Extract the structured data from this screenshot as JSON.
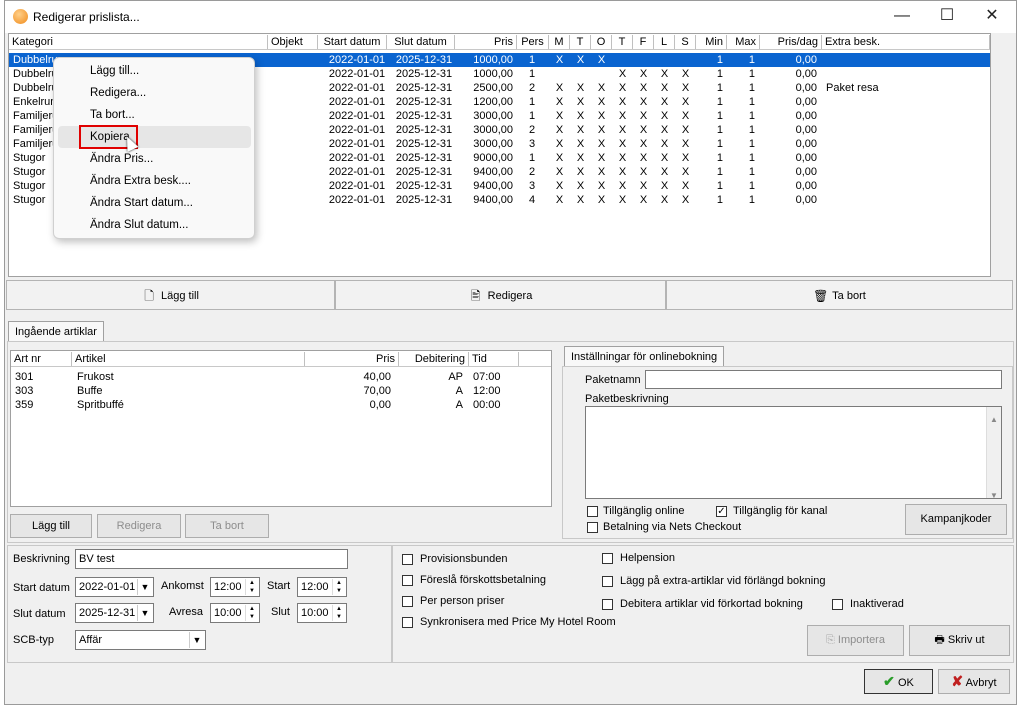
{
  "window": {
    "title": "Redigerar prislista...",
    "minimize": "—",
    "maximize": "☐",
    "close": "✕"
  },
  "grid": {
    "columns": [
      "Kategori",
      "Objekt",
      "Start datum",
      "Slut datum",
      "Pris",
      "Pers",
      "M",
      "T",
      "O",
      "T",
      "F",
      "L",
      "S",
      "Min",
      "Max",
      "Pris/dag",
      "Extra besk."
    ],
    "rows": [
      {
        "kat": "Dubbelru",
        "start": "2022-01-01",
        "slut": "2025-12-31",
        "pris": "1000,00",
        "pers": "1",
        "days": [
          "X",
          "X",
          "X",
          "",
          "",
          "",
          ""
        ],
        "min": "1",
        "max": "1",
        "pd": "0,00",
        "extra": ""
      },
      {
        "kat": "Dubbelru",
        "start": "2022-01-01",
        "slut": "2025-12-31",
        "pris": "1000,00",
        "pers": "1",
        "days": [
          "",
          "",
          "",
          "X",
          "X",
          "X",
          "X"
        ],
        "min": "1",
        "max": "1",
        "pd": "0,00",
        "extra": ""
      },
      {
        "kat": "Dubbelru",
        "start": "2022-01-01",
        "slut": "2025-12-31",
        "pris": "2500,00",
        "pers": "2",
        "days": [
          "X",
          "X",
          "X",
          "X",
          "X",
          "X",
          "X"
        ],
        "min": "1",
        "max": "1",
        "pd": "0,00",
        "extra": "Paket resa"
      },
      {
        "kat": "Enkelrun",
        "start": "2022-01-01",
        "slut": "2025-12-31",
        "pris": "1200,00",
        "pers": "1",
        "days": [
          "X",
          "X",
          "X",
          "X",
          "X",
          "X",
          "X"
        ],
        "min": "1",
        "max": "1",
        "pd": "0,00",
        "extra": ""
      },
      {
        "kat": "Familjeru",
        "start": "2022-01-01",
        "slut": "2025-12-31",
        "pris": "3000,00",
        "pers": "1",
        "days": [
          "X",
          "X",
          "X",
          "X",
          "X",
          "X",
          "X"
        ],
        "min": "1",
        "max": "1",
        "pd": "0,00",
        "extra": ""
      },
      {
        "kat": "Familjeru",
        "start": "2022-01-01",
        "slut": "2025-12-31",
        "pris": "3000,00",
        "pers": "2",
        "days": [
          "X",
          "X",
          "X",
          "X",
          "X",
          "X",
          "X"
        ],
        "min": "1",
        "max": "1",
        "pd": "0,00",
        "extra": ""
      },
      {
        "kat": "Familjeru",
        "start": "2022-01-01",
        "slut": "2025-12-31",
        "pris": "3000,00",
        "pers": "3",
        "days": [
          "X",
          "X",
          "X",
          "X",
          "X",
          "X",
          "X"
        ],
        "min": "1",
        "max": "1",
        "pd": "0,00",
        "extra": ""
      },
      {
        "kat": "Stugor",
        "start": "2022-01-01",
        "slut": "2025-12-31",
        "pris": "9000,00",
        "pers": "1",
        "days": [
          "X",
          "X",
          "X",
          "X",
          "X",
          "X",
          "X"
        ],
        "min": "1",
        "max": "1",
        "pd": "0,00",
        "extra": ""
      },
      {
        "kat": "Stugor",
        "start": "2022-01-01",
        "slut": "2025-12-31",
        "pris": "9400,00",
        "pers": "2",
        "days": [
          "X",
          "X",
          "X",
          "X",
          "X",
          "X",
          "X"
        ],
        "min": "1",
        "max": "1",
        "pd": "0,00",
        "extra": ""
      },
      {
        "kat": "Stugor",
        "start": "2022-01-01",
        "slut": "2025-12-31",
        "pris": "9400,00",
        "pers": "3",
        "days": [
          "X",
          "X",
          "X",
          "X",
          "X",
          "X",
          "X"
        ],
        "min": "1",
        "max": "1",
        "pd": "0,00",
        "extra": ""
      },
      {
        "kat": "Stugor",
        "start": "2022-01-01",
        "slut": "2025-12-31",
        "pris": "9400,00",
        "pers": "4",
        "days": [
          "X",
          "X",
          "X",
          "X",
          "X",
          "X",
          "X"
        ],
        "min": "1",
        "max": "1",
        "pd": "0,00",
        "extra": ""
      }
    ]
  },
  "context_menu": {
    "items": [
      "Lägg till...",
      "Redigera...",
      "Ta bort...",
      "Kopiera",
      "Ändra Pris...",
      "Ändra Extra besk....",
      "Ändra Start datum...",
      "Ändra Slut datum..."
    ],
    "highlighted": "Kopiera"
  },
  "toolbar": {
    "add": "Lägg till",
    "edit": "Redigera",
    "delete": "Ta bort"
  },
  "articles": {
    "tab": "Ingående artiklar",
    "columns": [
      "Art nr",
      "Artikel",
      "Pris",
      "Debitering",
      "Tid"
    ],
    "rows": [
      {
        "nr": "301",
        "name": "Frukost",
        "pris": "40,00",
        "deb": "AP",
        "tid": "07:00"
      },
      {
        "nr": "303",
        "name": "Buffe",
        "pris": "70,00",
        "deb": "A",
        "tid": "12:00"
      },
      {
        "nr": "359",
        "name": "Spritbuffé",
        "pris": "0,00",
        "deb": "A",
        "tid": "00:00"
      }
    ],
    "add": "Lägg till",
    "edit": "Redigera",
    "delete": "Ta bort"
  },
  "online": {
    "tab": "Inställningar för onlinebokning",
    "paketnamn_label": "Paketnamn",
    "paketnamn_value": "",
    "paketbesk_label": "Paketbeskrivning",
    "tillganglig_online": "Tillgänglig online",
    "tillganglig_online_checked": false,
    "tillganglig_kanal": "Tillgänglig för kanal",
    "tillganglig_kanal_checked": true,
    "nets": "Betalning via Nets Checkout",
    "nets_checked": false,
    "kampanj": "Kampanjkoder"
  },
  "form": {
    "beskrivning_label": "Beskrivning",
    "beskrivning": "BV test",
    "start_label": "Start datum",
    "start": "2022-01-01",
    "slut_label": "Slut datum",
    "slut": "2025-12-31",
    "ankomst_label": "Ankomst",
    "ankomst": "12:00",
    "avresa_label": "Avresa",
    "avresa": "10:00",
    "start_time_label": "Start",
    "start_time": "12:00",
    "slut_time_label": "Slut",
    "slut_time": "10:00",
    "scb_label": "SCB-typ",
    "scb": "Affär"
  },
  "options": {
    "provision": "Provisionsbunden",
    "forskott": "Föreslå förskottsbetalning",
    "perperson": "Per person priser",
    "sync": "Synkronisera med Price My Hotel Room",
    "helpension": "Helpension",
    "extra_forlangd": "Lägg på extra-artiklar vid förlängd bokning",
    "debitera_forkortad": "Debitera artiklar vid förkortad bokning",
    "inaktiverad": "Inaktiverad"
  },
  "actions": {
    "importera": "Importera",
    "skriv_ut": "Skriv ut",
    "ok": "OK",
    "avbryt": "Avbryt"
  },
  "colors": {
    "selection": "#0a64d0",
    "highlight_box": "#e00000",
    "ok_check": "#2a9d2a",
    "cancel_x": "#c02020"
  }
}
